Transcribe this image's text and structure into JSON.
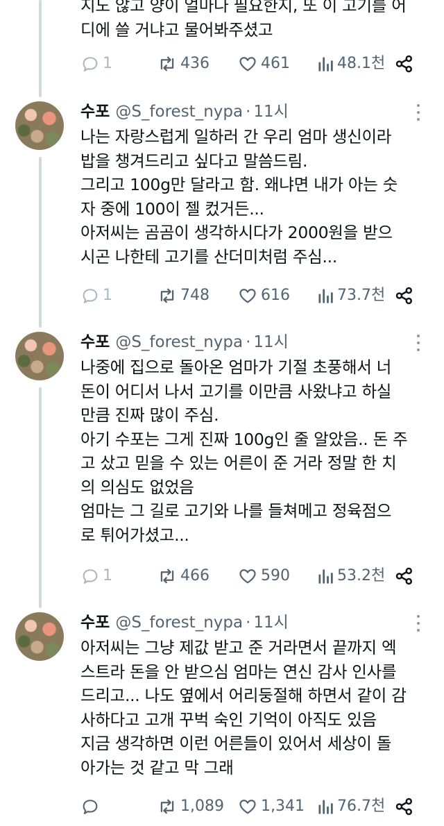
{
  "top_partial": {
    "body": "지도 않고 양이 얼마나 필요한지, 또 이 고기를 어\n디에 쓸 거냐고 물어봐주셨고",
    "stats": {
      "replies": "1",
      "retweets": "436",
      "likes": "461",
      "views": "48.1천"
    }
  },
  "tweets": [
    {
      "name": "수포",
      "handle": "@S_forest_nypa",
      "separator": "·",
      "time": "11시",
      "body": "나는 자랑스럽게 일하러 간 우리 엄마 생신이라\n밥을 챙겨드리고 싶다고 말씀드림.\n그리고 100g만 달라고 함. 왜냐면 내가 아는 숫\n자 중에 100이 젤 컸거든...\n아저씨는 곰곰이 생각하시다가 2000원을 받으\n시곤 나한테 고기를 산더미처럼 주심...",
      "stats": {
        "replies": "1",
        "retweets": "748",
        "likes": "616",
        "views": "73.7천"
      }
    },
    {
      "name": "수포",
      "handle": "@S_forest_nypa",
      "separator": "·",
      "time": "11시",
      "body": "나중에 집으로 돌아온 엄마가 기절 초풍해서 너\n돈이 어디서 나서 고기를 이만큼 사왔냐고 하실\n만큼 진짜 많이 주심.\n아기 수포는 그게 진짜 100g인 줄 알았음.. 돈 주\n고 샀고 믿을 수 있는 어른이 준 거라 정말 한 치\n의 의심도 없었음\n엄마는 그 길로 고기와 나를 들쳐메고 정육점으\n로 튀어가셨고...",
      "stats": {
        "replies": "1",
        "retweets": "466",
        "likes": "590",
        "views": "53.2천"
      }
    },
    {
      "name": "수포",
      "handle": "@S_forest_nypa",
      "separator": "·",
      "time": "11시",
      "body": "아저씨는 그냥 제값 받고 준 거라면서 끝까지 엑\n스트라 돈을 안 받으심 엄마는 연신 감사 인사를\n드리고... 나도 옆에서 어리둥절해 하면서 같이 감\n사하다고 고개 꾸벅 숙인 기억이 아직도 있음\n지금 생각하면 이런 어른들이 있어서 세상이 돌\n아가는 것 같고 막 그래",
      "stats": {
        "replies": "",
        "retweets": "1,089",
        "likes": "1,341",
        "views": "76.7천"
      }
    }
  ]
}
